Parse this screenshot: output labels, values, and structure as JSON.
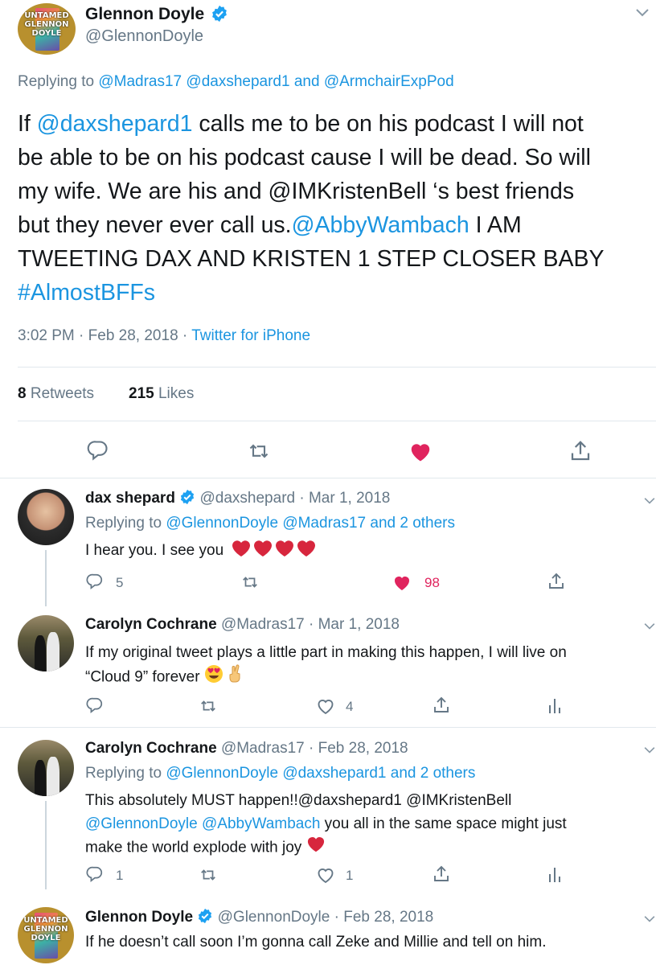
{
  "main_tweet": {
    "avatar_text": "UNTAMED GLENNON DOYLE",
    "display_name": "Glennon Doyle",
    "handle": "@GlennonDoyle",
    "replying_prefix": "Replying to",
    "replying_to": [
      "@Madras17",
      "@daxshepard1"
    ],
    "replying_and": "and",
    "replying_last": "@ArmchairExpPod",
    "text": {
      "line1_a": "If ",
      "line1_mention": "@daxshepard1",
      "line1_b": " calls me to be on his podcast I will not",
      "line2": "be able to be on his podcast cause I will be dead. So will",
      "line3": "my wife. We are his and @IMKristenBell ‘s best friends",
      "line4_a": "but they never ever call us.",
      "line4_mention": "@AbbyWambach",
      "line4_b": " I AM",
      "line5": "TWEETING DAX AND KRISTEN 1 STEP CLOSER BABY",
      "hashtag": "#AlmostBFFs"
    },
    "time": "3:02 PM",
    "dot": "·",
    "date": "Feb 28, 2018",
    "source": "Twitter for iPhone",
    "retweets_count": "8",
    "retweets_label": "Retweets",
    "likes_count": "215",
    "likes_label": "Likes",
    "liked_color": "#e0245e"
  },
  "replies": [
    {
      "display_name": "dax shepard",
      "handle": "@daxshepard",
      "date": "· Mar 1, 2018",
      "replying_prefix": "Replying to",
      "replying_to": "@GlennonDoyle @Madras17 and 2 others",
      "text": "I hear you. I see you",
      "reply_count": "5",
      "like_count": "98"
    },
    {
      "display_name": "Carolyn Cochrane",
      "handle": "@Madras17",
      "date": "· Mar 1, 2018",
      "text_line1": "If my original tweet plays a little part in making this happen, I will live on",
      "text_line2": "“Cloud 9” forever",
      "like_count": "4"
    },
    {
      "display_name": "Carolyn Cochrane",
      "handle": "@Madras17",
      "date": "· Feb 28, 2018",
      "replying_prefix": "Replying to",
      "replying_to": "@GlennonDoyle @daxshepard1 and 2 others",
      "text_line1": "This absolutely MUST happen!!@daxshepard1 @IMKristenBell",
      "text_line2_mentions": "@GlennonDoyle @AbbyWambach",
      "text_line2_rest": " you all in the same space might just",
      "text_line3": "make the world explode with joy",
      "reply_count": "1",
      "like_count": "1"
    },
    {
      "avatar_text": "UNTAMED GLENNON DOYLE",
      "display_name": "Glennon Doyle",
      "handle": "@GlennonDoyle",
      "date": "· Feb 28, 2018",
      "text": "If he doesn’t call soon I’m gonna call Zeke and Millie and tell on him."
    }
  ],
  "icons": {
    "verified_color": "#1da1f2",
    "icon_gray": "#657786",
    "link_color": "#1b95e0"
  }
}
